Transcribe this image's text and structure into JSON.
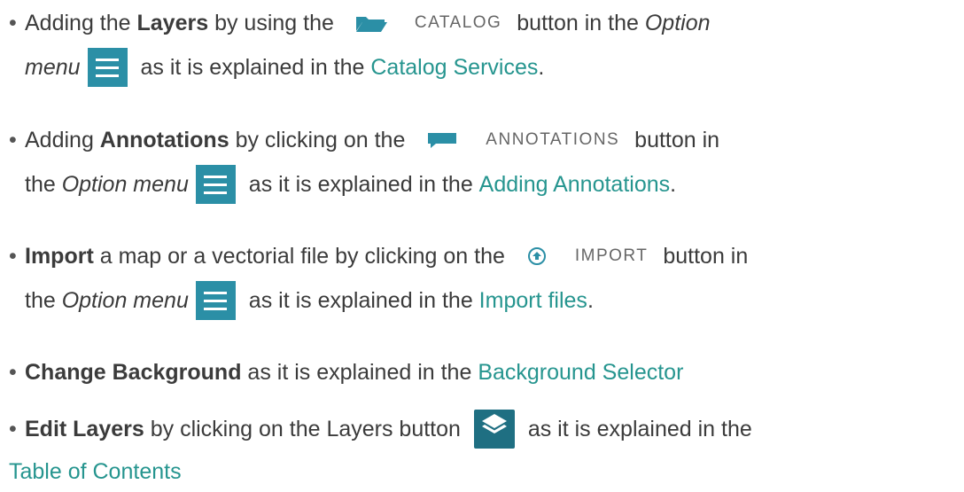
{
  "items": [
    {
      "l1_a": "Adding the ",
      "l1_b": "Layers",
      "l1_c": " by using the ",
      "btn_label": "CATALOG",
      "l1_d": " button in the ",
      "l1_e": "Option",
      "l2_a": "menu",
      "l2_b": " as it is explained in the ",
      "link": "Catalog Services",
      "l2_c": "."
    },
    {
      "l1_a": "Adding ",
      "l1_b": "Annotations",
      "l1_c": " by clicking on the ",
      "btn_label": "ANNOTATIONS",
      "l1_d": " button in",
      "l2_a": "the ",
      "l2_b": "Option menu",
      "l2_c": " as it is explained in the ",
      "link": "Adding Annotations",
      "l2_d": "."
    },
    {
      "l1_a": "Import",
      "l1_b": " a map or a vectorial file by clicking on the ",
      "btn_label": "IMPORT",
      "l1_c": " button in",
      "l2_a": "the ",
      "l2_b": "Option menu",
      "l2_c": " as it is explained in the ",
      "link": "Import files",
      "l2_d": "."
    },
    {
      "l1_a": "Change Background",
      "l1_b": " as it is explained in the ",
      "link": "Background Selector"
    },
    {
      "l1_a": "Edit Layers",
      "l1_b": " by clicking on the Layers button ",
      "l1_c": " as it is explained in the",
      "link": "Table of Contents"
    }
  ],
  "icons": {
    "catalog": "folder-icon",
    "annotations": "comment-icon",
    "import": "upload-icon",
    "menu": "hamburger-menu-icon",
    "layers": "layers-icon"
  },
  "colors": {
    "link": "#26958f",
    "menu_button": "#2b8fa6",
    "layers_button": "#1f6f82",
    "text": "#3b3b3b"
  }
}
